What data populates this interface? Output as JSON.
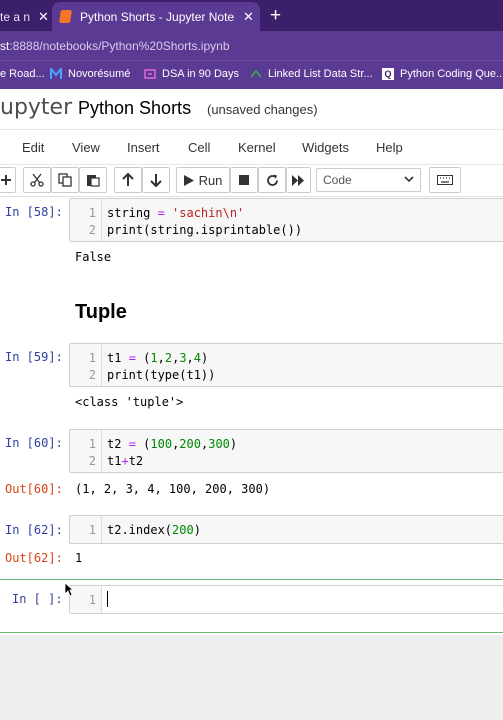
{
  "browser": {
    "tabs": [
      {
        "label": "te a n"
      },
      {
        "label": "Python Shorts - Jupyter Notebook"
      }
    ],
    "new_tab": "+",
    "url": {
      "host": "st",
      "rest": ":8888/notebooks/Python%20Shorts.ipynb"
    },
    "bookmarks": [
      "e Road...",
      "Novorésumé",
      "DSA in 90 Days",
      "Linked List Data Str...",
      "Python Coding Que..."
    ]
  },
  "jupyter": {
    "logo": "upyter",
    "notebook_title": "Python Shorts",
    "status": "(unsaved changes)",
    "menu": [
      "Edit",
      "View",
      "Insert",
      "Cell",
      "Kernel",
      "Widgets",
      "Help"
    ],
    "toolbar": {
      "run_label": "Run",
      "cell_type": "Code"
    }
  },
  "cells": {
    "c58": {
      "prompt": "In [58]:",
      "lines": [
        "1",
        "2"
      ],
      "output": "False"
    },
    "heading": "Tuple",
    "c59": {
      "prompt": "In [59]:",
      "lines": [
        "1",
        "2"
      ],
      "output": "<class 'tuple'>"
    },
    "c60": {
      "prompt": "In [60]:",
      "lines": [
        "1",
        "2"
      ],
      "out_prompt": "Out[60]:",
      "output": "(1, 2, 3, 4, 100, 200, 300)"
    },
    "c62": {
      "prompt": "In [62]:",
      "lines": [
        "1"
      ],
      "out_prompt": "Out[62]:",
      "output": "1"
    },
    "empty": {
      "prompt": "In [ ]:",
      "lines": [
        "1"
      ]
    }
  },
  "code": {
    "c58_l1": {
      "a": "string ",
      "op": "=",
      "str": " 'sachin\\n'"
    },
    "c58_l2": "print(string.isprintable())",
    "c59_l1": {
      "a": "t1 ",
      "op": "=",
      "b": " (",
      "nums": [
        "1",
        "2",
        "3",
        "4"
      ],
      "c": ")"
    },
    "c59_l2": "print(type(t1))",
    "c60_l1": {
      "a": "t2 ",
      "op": "=",
      "b": " (",
      "nums": [
        "100",
        "200",
        "300"
      ],
      "c": ")"
    },
    "c60_l2": {
      "a": "t1",
      "op": "+",
      "b": "t2"
    },
    "c62_l1": {
      "a": "t2.index(",
      "num": "200",
      "b": ")"
    }
  },
  "colors": {
    "browser_dark": "#3c1f6b",
    "browser_chrome": "#5b3a93",
    "jupyter_orange": "#f37726",
    "in_prompt": "#303f9f",
    "out_prompt": "#d84315",
    "selected_border": "#66bb6a"
  }
}
